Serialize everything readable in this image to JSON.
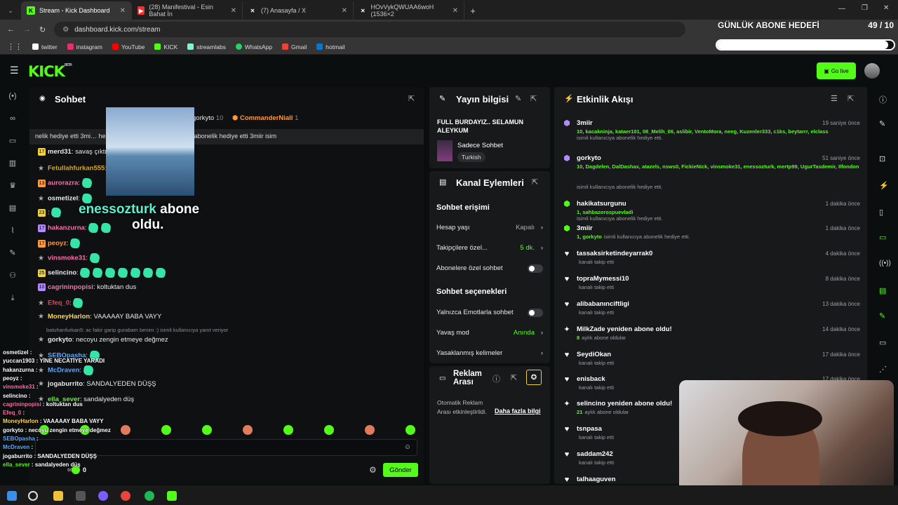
{
  "browser": {
    "tabs": [
      {
        "title": "Stream - Kick Dashboard",
        "icon": "kick-icon",
        "color": "#53fc18"
      },
      {
        "title": "(28) Manifestival - Esin Bahat İn",
        "icon": "youtube-icon",
        "color": "#ff2d2d"
      },
      {
        "title": "(7) Anasayfa / X",
        "icon": "x-icon",
        "color": "#ffffff"
      },
      {
        "title": "HOvVykQWUAA6woH (1536×2",
        "icon": "x-icon",
        "color": "#ffffff"
      }
    ],
    "url": "dashboard.kick.com/stream",
    "bookmarks": [
      {
        "label": "twitter",
        "color": "#ffffff"
      },
      {
        "label": "instagram",
        "color": "#e1306c"
      },
      {
        "label": "YouTube",
        "color": "#ff0000"
      },
      {
        "label": "KICK",
        "color": "#53fc18"
      },
      {
        "label": "streamlabs",
        "color": "#80f5d2"
      },
      {
        "label": "WhatsApp",
        "color": "#25d366"
      },
      {
        "label": "Gmail",
        "color": "#ea4335"
      },
      {
        "label": "hotmail",
        "color": "#0078d4"
      }
    ]
  },
  "header": {
    "logo": "KICK",
    "logo_beta": "BETA",
    "go_live": "Go live"
  },
  "goal": {
    "title": "GÜNLÜK ABONE HEDEFİ",
    "count": "49 / 10",
    "progress": 0.97
  },
  "chat": {
    "title": "Sohbet",
    "pinned": {
      "users": "gorkyto",
      "count": "10",
      "top": "CommanderNiall",
      "top_count": "1"
    },
    "gift_banner": "nelik hediye etti  3mi… hediye etti  3miir isimli kullanıcı 10 abonelik hediye etti  3miir isim",
    "messages": [
      {
        "badge": "17",
        "user": "merd31",
        "color": "#e7e9ea",
        "text": "savaş çıktı"
      },
      {
        "badge": "",
        "user": "Fetullahfurkan555",
        "color": "#d3a52a",
        "text": ""
      },
      {
        "badge": "13",
        "user": "aurorazra",
        "color": "#ff6ea8",
        "text": ""
      },
      {
        "badge": "",
        "user": "osmetizel",
        "color": "#e7e9ea",
        "text": ""
      },
      {
        "badge": "23",
        "user": "",
        "color": "#e7e9ea",
        "text": ""
      },
      {
        "badge": "17",
        "user": "hakanzurna",
        "color": "#ff6ea8",
        "text": ""
      },
      {
        "badge": "17",
        "user": "peoyz",
        "color": "#ff9a3c",
        "text": ""
      },
      {
        "badge": "",
        "user": "vinsmoke31",
        "color": "#ff6ea8",
        "text": ""
      },
      {
        "badge": "25",
        "user": "selincino",
        "color": "#e7e9ea",
        "text": ""
      },
      {
        "badge": "10",
        "user": "cagrininpopisi",
        "color": "#ff6ea8",
        "text": "koltuktan dus"
      },
      {
        "badge": "",
        "user": "Efeq_0",
        "color": "#d9475b",
        "text": ""
      },
      {
        "badge": "",
        "user": "MoneyHarlon",
        "color": "#ffd84a",
        "text": "VAAAAAY BABA VAYY"
      },
      {
        "badge": "",
        "user": "gorkyto",
        "color": "#e7e9ea",
        "text": "necoyu zengin etmeye değmez"
      },
      {
        "badge": "",
        "user": "SEBOpasha",
        "color": "#5aa8ff",
        "text": ""
      },
      {
        "badge": "",
        "user": "McDraven",
        "color": "#5aa8ff",
        "text": ""
      },
      {
        "badge": "",
        "user": "jogaburrito",
        "color": "#e7e9ea",
        "text": "SANDALYEDEN DÜŞŞ"
      },
      {
        "badge": "",
        "user": "ella_sever",
        "color": "#53fc18",
        "text": "sandalyeden düş"
      }
    ],
    "reply_hint": "batuhanfurkan5: ac fakir garip gurabam benim :) isimli kullanıcıya yanıt veriyor",
    "send": "Gönder",
    "kick_count": "0"
  },
  "stream_info": {
    "title": "Yayın bilgisi",
    "stream_title": "FULL BURDAYIZ.. SELAMUN ALEYKUM",
    "category": "Sadece Sohbet",
    "language": "Turkish"
  },
  "channel_actions": {
    "title": "Kanal Eylemleri",
    "access_title": "Sohbet erişimi",
    "account_age": {
      "label": "Hesap yaşı",
      "value": "Kapalı"
    },
    "followers_only": {
      "label": "Takipçilere özel...",
      "value": "5 dk."
    },
    "subs_only": {
      "label": "Abonelere özel sohbet"
    },
    "options_title": "Sohbet seçenekleri",
    "emotes_only": {
      "label": "Yalnızca Emotlarla sohbet"
    },
    "slow_mode": {
      "label": "Yavaş mod",
      "value": "Anında"
    },
    "banned_words": {
      "label": "Yasaklanmış kelimeler"
    }
  },
  "ad_break": {
    "title": "Reklam Arası",
    "desc": "Otomatik Reklam Arası etkinleştirildi.",
    "more": "Daha fazla bilgi"
  },
  "activity": {
    "title": "Etkinlik Akışı",
    "items": [
      {
        "icon": "gift-icon",
        "name": "3miir",
        "time": "19 saniye önce",
        "list": "10, kacakninja, kataer101, 08_Melih_06, aslibir, VentoMora, neeg, Kuzenler333, c1ks, beytarrr, elclass",
        "text": "isimli kullanıcıya abonelik hediye etti.",
        "color": "#b38bff"
      },
      {
        "icon": "gift-icon",
        "name": "gorkyto",
        "time": "51 saniye önce",
        "list": "10, Dagdelen, DalDashax, atazels, nsws0, FickieNick, vinsmoke31, enessozturk, mertp99, UgurTasdemir, Ilfondon",
        "text": "isimli kullanıcıya abonelik hediye etti.",
        "color": "#b38bff"
      },
      {
        "icon": "gift-icon",
        "name": "hakikatsurgunu",
        "time": "1 dakika önce",
        "list": "1, sahbazorospuevladi",
        "text": "isimli kullanıcıya abonelik hediye etti.",
        "color": "#53fc18"
      },
      {
        "icon": "gift-icon",
        "name": "3miir",
        "time": "1 dakika önce",
        "list": "1, gorkyto",
        "text": "isimli kullanıcıya abonelik hediye etti.",
        "color": "#53fc18"
      },
      {
        "icon": "heart-icon",
        "name": "tassaksirketindeyarrak0",
        "time": "4 dakika önce",
        "list": "",
        "text": "kanalı takip etti"
      },
      {
        "icon": "heart-icon",
        "name": "topraMymessi10",
        "time": "8 dakika önce",
        "list": "",
        "text": "kanalı takip etti"
      },
      {
        "icon": "heart-icon",
        "name": "alibabanınciftligi",
        "time": "13 dakika önce",
        "list": "",
        "text": "kanalı takip etti"
      },
      {
        "icon": "star-icon",
        "name": "MilkZade yeniden abone oldu!",
        "time": "14 dakika önce",
        "list": "8",
        "text": "aylık abone oldular"
      },
      {
        "icon": "heart-icon",
        "name": "SeydiOkan",
        "time": "17 dakika önce",
        "list": "",
        "text": "kanalı takip etti"
      },
      {
        "icon": "heart-icon",
        "name": "enisback",
        "time": "17 dakika önce",
        "list": "",
        "text": "kanalı takip etti"
      },
      {
        "icon": "star-icon",
        "name": "selincino yeniden abone oldu!",
        "time": "",
        "list": "21",
        "text": "aylık abone oldular"
      },
      {
        "icon": "heart-icon",
        "name": "tsnpasa",
        "time": "",
        "list": "",
        "text": "kanalı takip etti"
      },
      {
        "icon": "heart-icon",
        "name": "saddam242",
        "time": "",
        "list": "",
        "text": "kanalı takip etti"
      },
      {
        "icon": "heart-icon",
        "name": "talhaaguven",
        "time": "",
        "list": "",
        "text": ""
      }
    ]
  },
  "overlay": {
    "alert_user": "enessozturk",
    "alert_text": "abone",
    "alert_text2": "oldu.",
    "chat": [
      {
        "user": "osmetizel",
        "text": "",
        "color": "#ffffff"
      },
      {
        "user": "yuccan1903",
        "text": "YİNE NECATİYE YARADI",
        "color": "#ffffff"
      },
      {
        "user": "hakanzurna",
        "text": "",
        "color": "#ffffff"
      },
      {
        "user": "peoyz",
        "text": "",
        "color": "#ffffff"
      },
      {
        "user": "vinsmoke31",
        "text": "",
        "color": "#ff6ea8"
      },
      {
        "user": "selincino",
        "text": "",
        "color": "#ffffff"
      },
      {
        "user": "cagrininpopisi",
        "text": "koltuktan dus",
        "color": "#ff6ea8"
      },
      {
        "user": "Efeq_0",
        "text": "",
        "color": "#ff6ea8"
      },
      {
        "user": "MoneyHarlon",
        "text": "VAAAAAY BABA VAYY",
        "color": "#ffd84a"
      },
      {
        "user": "gorkyto",
        "text": "necoyu zengin etmeye değmez",
        "color": "#ffffff"
      },
      {
        "user": "SEBOpasha",
        "text": "",
        "color": "#5aa8ff"
      },
      {
        "user": "McDraven",
        "text": "",
        "color": "#5aa8ff"
      },
      {
        "user": "jogaburrito",
        "text": "SANDALYEDEN DÜŞŞ",
        "color": "#ffffff"
      },
      {
        "user": "ella_sever",
        "text": "sandalyeden düş",
        "color": "#53fc18"
      }
    ]
  }
}
